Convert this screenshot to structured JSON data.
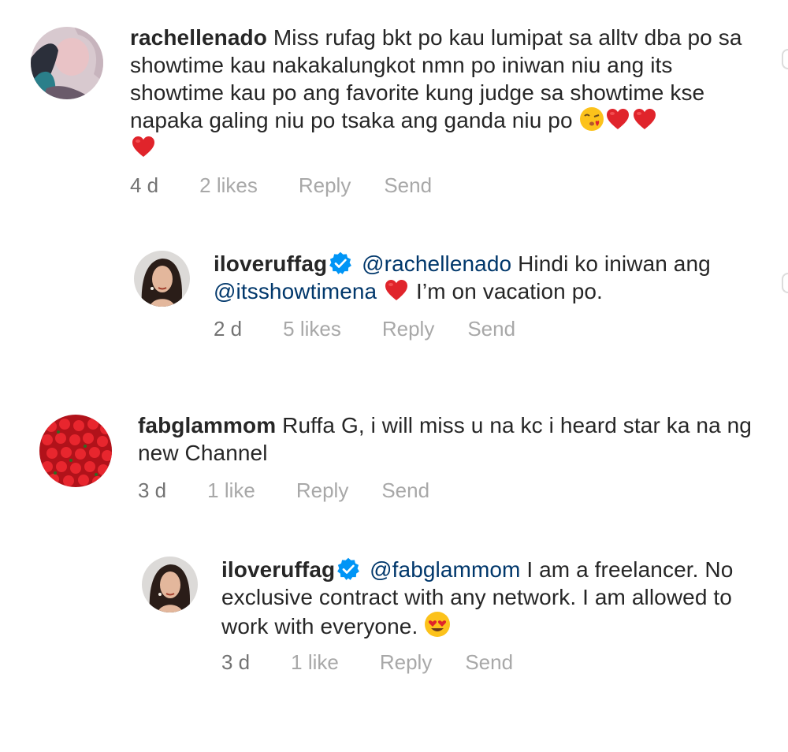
{
  "colors": {
    "text": "#262626",
    "meta": "#a8a8a8",
    "mention": "#00376b",
    "verified": "#0095f6",
    "heart": "#e0242b"
  },
  "comments": [
    {
      "username": "rachellenado",
      "text": "Miss rufag bkt po kau lumipat sa alltv dba po sa showtime kau nakakalungkot nmn po iniwan niu ang its showtime kau po ang favorite kung judge sa showtime kse napaka galing niu po tsaka ang ganda niu po",
      "emojis": [
        "kissing-face",
        "red-heart",
        "red-heart",
        "red-heart"
      ],
      "time": "4 d",
      "likes": "2 likes",
      "reply": "Reply",
      "send": "Send"
    },
    {
      "username": "iloveruffag",
      "mention": "@rachellenado",
      "text_a": "Hindi ko iniwan ang",
      "mention2": "@itsshowtimena",
      "text_b": "I’m on vacation po.",
      "time": "2 d",
      "likes": "5 likes",
      "reply": "Reply",
      "send": "Send"
    },
    {
      "username": "fabglammom",
      "text": "Ruffa G, i will miss u na kc i heard star ka na ng new Channel",
      "time": "3 d",
      "likes": "1 like",
      "reply": "Reply",
      "send": "Send"
    },
    {
      "username": "iloveruffag",
      "mention": "@fabglammom",
      "text": "I am a freelancer. No exclusive contract with any network. I am allowed to work with everyone.",
      "emojis": [
        "heart-eyes-face"
      ],
      "time": "3 d",
      "likes": "1 like",
      "reply": "Reply",
      "send": "Send"
    }
  ]
}
